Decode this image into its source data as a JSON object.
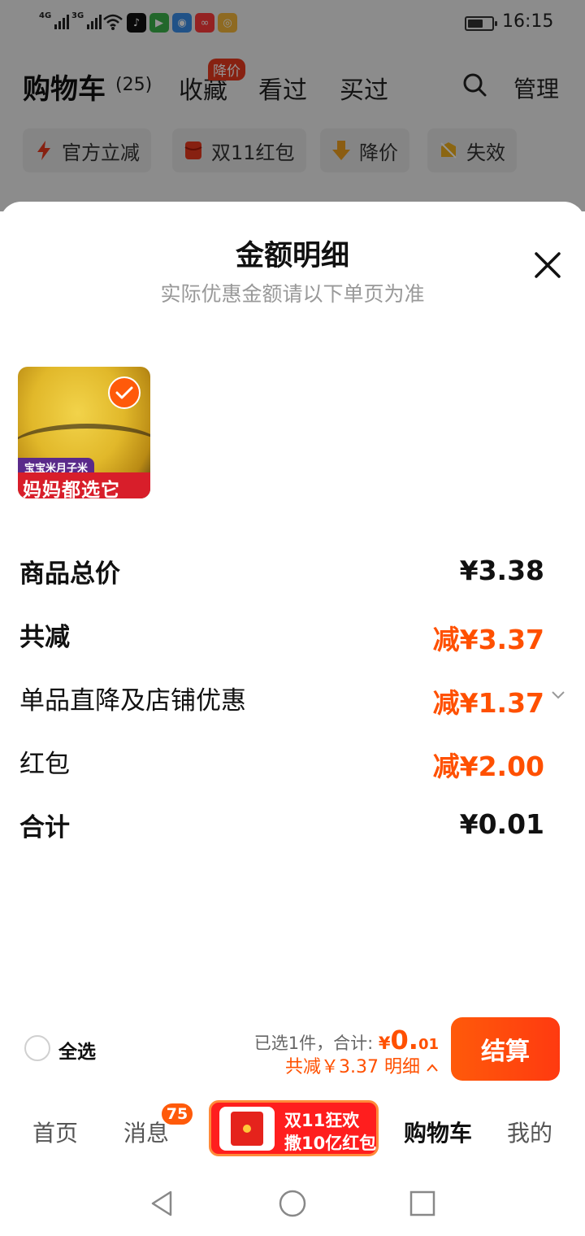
{
  "status_bar": {
    "signal1_label": "4G",
    "signal2_label": "3G",
    "time": "16:15"
  },
  "top_nav": {
    "cart_title": "购物车",
    "cart_count": "(25)",
    "tabs": [
      {
        "label": "收藏"
      },
      {
        "label": "看过"
      },
      {
        "label": "买过"
      }
    ],
    "price_drop_badge": "降价",
    "manage_label": "管理"
  },
  "filter_chips": [
    {
      "label": "官方立减",
      "icon": "lightning-icon"
    },
    {
      "label": "双11红包",
      "icon": "red-packet-icon"
    },
    {
      "label": "降价",
      "icon": "arrow-down-icon"
    },
    {
      "label": "失效",
      "icon": "expired-icon"
    }
  ],
  "sheet": {
    "title": "金额明细",
    "subtitle": "实际优惠金额请以下单页为准",
    "product": {
      "tag_top": "宝宝米月子米",
      "tag_bottom": "妈妈都选它",
      "selected": true
    },
    "rows": [
      {
        "label": "商品总价",
        "value": "¥3.38"
      },
      {
        "label": "共减",
        "value": "减¥3.37"
      },
      {
        "label": "单品直降及店铺优惠",
        "value": "减¥1.37"
      },
      {
        "label": "红包",
        "value": "减¥2.00"
      },
      {
        "label": "合计",
        "value": "¥0.01"
      }
    ]
  },
  "bottom_bar": {
    "select_all_label": "全选",
    "selected_text": "已选1件，合计:",
    "total_symbol": "¥",
    "total_int": "0.",
    "total_dec": "01",
    "discount_text": "共减￥3.37 明细",
    "checkout_label": "结算"
  },
  "tab_bar": {
    "home": "首页",
    "messages": "消息",
    "messages_badge": "75",
    "promo_line1": "双11狂欢",
    "promo_line2": "撒10亿红包",
    "cart": "购物车",
    "mine": "我的"
  },
  "colors": {
    "accent": "#ff5000",
    "checkout": "#ff4a0a",
    "badge": "#e8391e"
  }
}
